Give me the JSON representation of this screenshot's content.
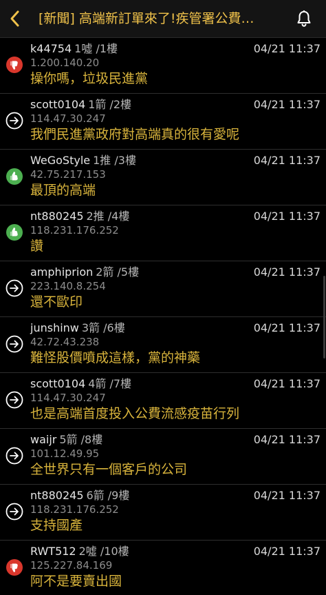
{
  "header": {
    "title": "[新聞] 高端新訂單來了!疾管署公費…",
    "back_icon": "chevron-left-icon",
    "bell_icon": "bell-icon"
  },
  "colors": {
    "title": "#f0c24a",
    "content": "#d9b43c",
    "push": "#4caf50",
    "boo": "#d9372c",
    "arrow": "#ffffff"
  },
  "comments": [
    {
      "type": "boo",
      "user": "k44754",
      "floor": "1噓 /1樓",
      "time": "04/21 11:37",
      "ip": "1.200.140.20",
      "content": "操你嗎，垃圾民進黨"
    },
    {
      "type": "arrow",
      "user": "scott0104",
      "floor": "1箭 /2樓",
      "time": "04/21 11:37",
      "ip": "114.47.30.247",
      "content": "我們民進黨政府對高端真的很有愛呢"
    },
    {
      "type": "push",
      "user": "WeGoStyle",
      "floor": "1推 /3樓",
      "time": "04/21 11:37",
      "ip": "42.75.217.153",
      "content": "最頂的高端"
    },
    {
      "type": "push",
      "user": "nt880245",
      "floor": "2推 /4樓",
      "time": "04/21 11:37",
      "ip": "118.231.176.252",
      "content": "讚"
    },
    {
      "type": "arrow",
      "user": "amphiprion",
      "floor": "2箭 /5樓",
      "time": "04/21 11:37",
      "ip": "223.140.8.254",
      "content": "還不歐印"
    },
    {
      "type": "arrow",
      "user": "junshinw",
      "floor": "3箭 /6樓",
      "time": "04/21 11:37",
      "ip": "42.72.43.238",
      "content": "難怪股價噴成這樣，黨的神藥"
    },
    {
      "type": "arrow",
      "user": "scott0104",
      "floor": "4箭 /7樓",
      "time": "04/21 11:37",
      "ip": "114.47.30.247",
      "content": "也是高端首度投入公費流感疫苗行列"
    },
    {
      "type": "arrow",
      "user": "waijr",
      "floor": "5箭 /8樓",
      "time": "04/21 11:37",
      "ip": "101.12.49.95",
      "content": "全世界只有一個客戶的公司"
    },
    {
      "type": "arrow",
      "user": "nt880245",
      "floor": "6箭 /9樓",
      "time": "04/21 11:37",
      "ip": "118.231.176.252",
      "content": "支持國產"
    },
    {
      "type": "boo",
      "user": "RWT512",
      "floor": "2噓 /10樓",
      "time": "04/21 11:37",
      "ip": "125.227.84.169",
      "content": "阿不是要賣出國"
    }
  ]
}
